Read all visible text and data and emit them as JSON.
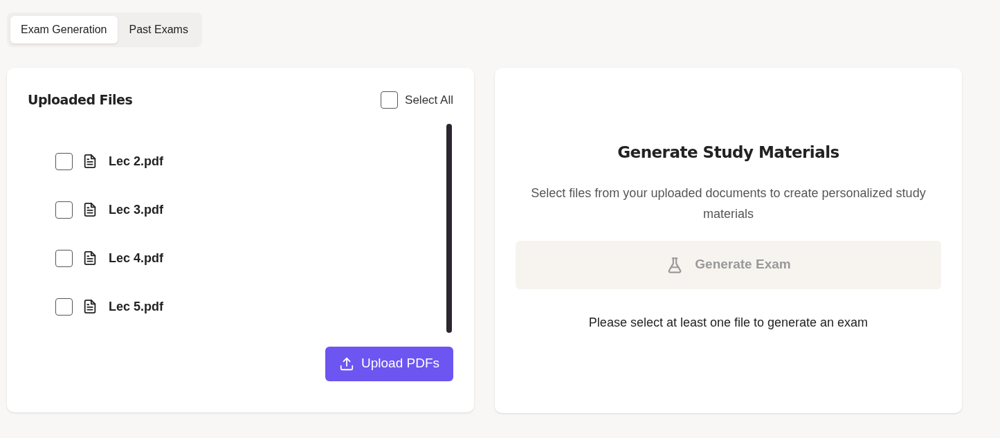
{
  "tabs": [
    {
      "label": "Exam Generation",
      "selected": true
    },
    {
      "label": "Past Exams",
      "selected": false
    }
  ],
  "uploaded_files": {
    "title": "Uploaded Files",
    "select_all": {
      "label": "Select All",
      "checked": false
    },
    "files": [
      {
        "name": "Lec 2.pdf",
        "checked": false
      },
      {
        "name": "Lec 3.pdf",
        "checked": false
      },
      {
        "name": "Lec 4.pdf",
        "checked": false
      },
      {
        "name": "Lec 5.pdf",
        "checked": false
      }
    ],
    "upload_button": "Upload PDFs"
  },
  "generate": {
    "title": "Generate Study Materials",
    "description": "Select files from your uploaded documents to create personalized study materials",
    "button": {
      "label": "Generate Exam",
      "disabled": true
    },
    "note": "Please select at least one file to generate an exam"
  }
}
